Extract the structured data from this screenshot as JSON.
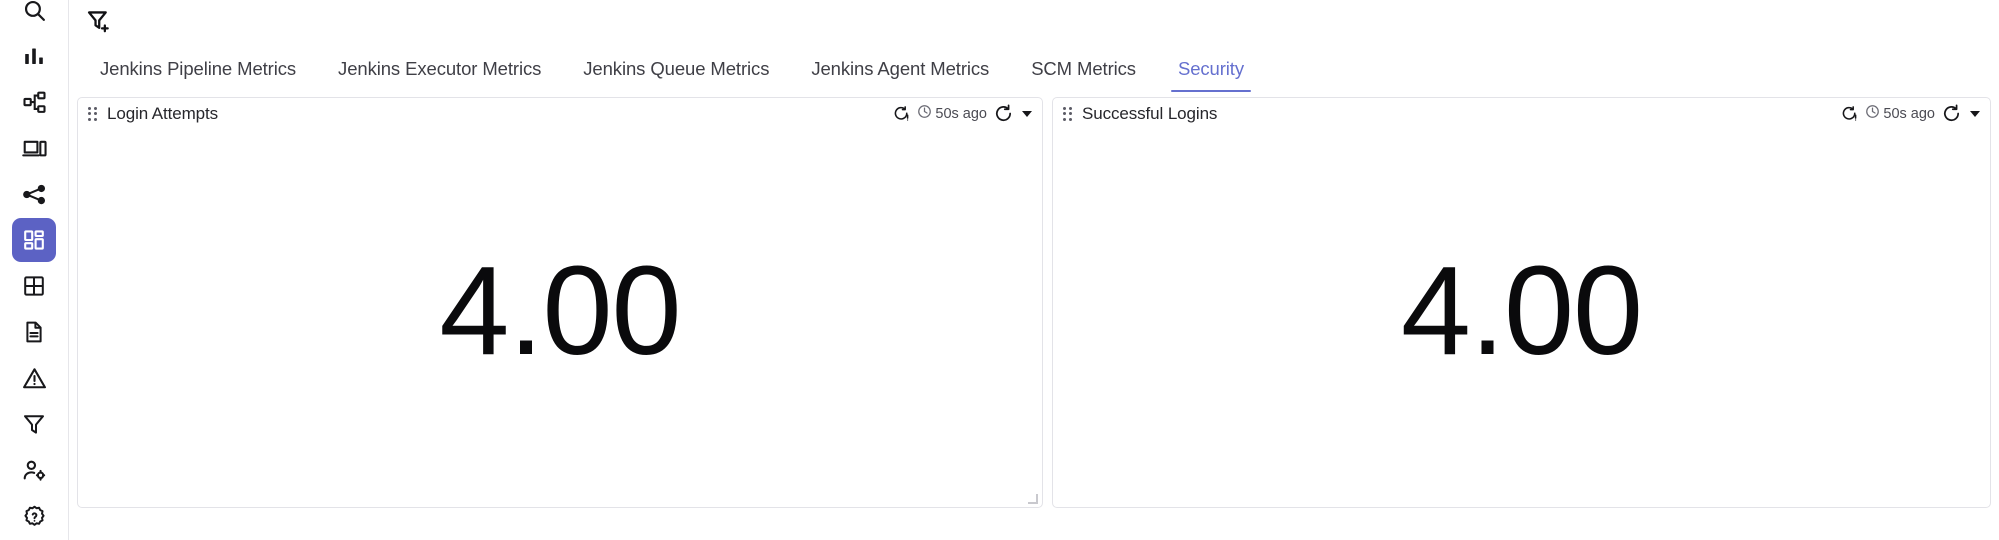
{
  "sidebar": {
    "items": [
      {
        "name": "search-icon",
        "label": "Search"
      },
      {
        "name": "bar-chart-icon",
        "label": "Metrics"
      },
      {
        "name": "topology-icon",
        "label": "Topology"
      },
      {
        "name": "devices-icon",
        "label": "Devices"
      },
      {
        "name": "share-nodes-icon",
        "label": "Traces"
      },
      {
        "name": "dashboards-icon",
        "label": "Dashboards",
        "active": true
      },
      {
        "name": "grid-icon",
        "label": "Grid"
      },
      {
        "name": "document-icon",
        "label": "Logs"
      },
      {
        "name": "alert-triangle-icon",
        "label": "Alerts"
      },
      {
        "name": "filter-icon",
        "label": "Filters"
      },
      {
        "name": "user-settings-icon",
        "label": "Users"
      },
      {
        "name": "gear-help-icon",
        "label": "Settings"
      }
    ]
  },
  "toolbar": {
    "add_filter_label": "Add filter"
  },
  "tabs": [
    {
      "label": "Jenkins Pipeline Metrics",
      "active": false
    },
    {
      "label": "Jenkins Executor Metrics",
      "active": false
    },
    {
      "label": "Jenkins Queue Metrics",
      "active": false
    },
    {
      "label": "Jenkins Agent Metrics",
      "active": false
    },
    {
      "label": "SCM Metrics",
      "active": false
    },
    {
      "label": "Security",
      "active": true
    }
  ],
  "panels": [
    {
      "title": "Login Attempts",
      "value": "4.00",
      "refresh_status": "50s ago",
      "has_resize_grip": true
    },
    {
      "title": "Successful Logins",
      "value": "4.00",
      "refresh_status": "50s ago",
      "has_resize_grip": false
    }
  ],
  "colors": {
    "accent": "#6570cf",
    "sidebar_active_bg": "#5c62c4",
    "panel_border": "#e3e3e8",
    "text_primary": "#27272c"
  }
}
